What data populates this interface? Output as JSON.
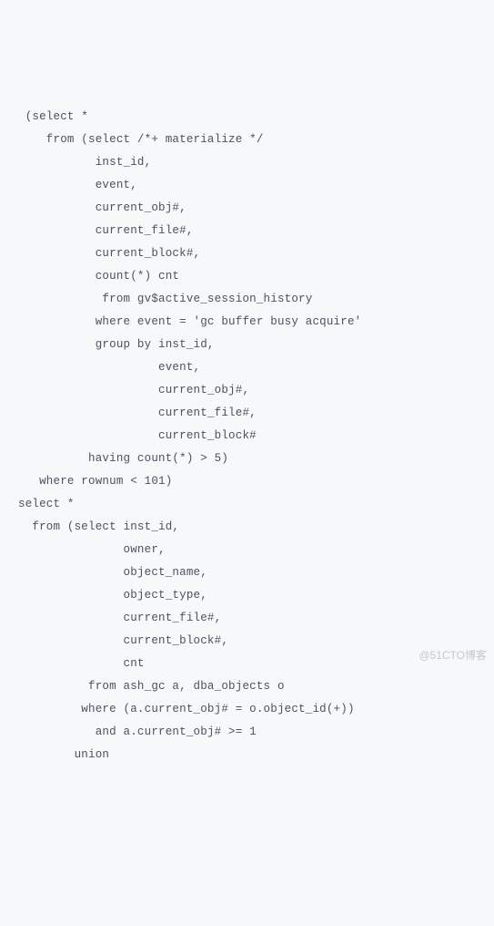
{
  "code": {
    "lines": [
      " (select *",
      "    from (select /*+ materialize */",
      "           inst_id,",
      "           event,",
      "           current_obj#,",
      "           current_file#,",
      "           current_block#,",
      "           count(*) cnt",
      "            from gv$active_session_history",
      "           where event = 'gc buffer busy acquire'",
      "           group by inst_id,",
      "                    event,",
      "                    current_obj#,",
      "                    current_file#,",
      "                    current_block#",
      "          having count(*) > 5)",
      "   where rownum < 101)",
      "select *",
      "  from (select inst_id,",
      "               owner,",
      "               object_name,",
      "               object_type,",
      "               current_file#,",
      "               current_block#,",
      "               cnt",
      "          from ash_gc a, dba_objects o",
      "         where (a.current_obj# = o.object_id(+))",
      "           and a.current_obj# >= 1",
      "        union"
    ]
  },
  "watermark": {
    "text": "@51CTO博客"
  }
}
